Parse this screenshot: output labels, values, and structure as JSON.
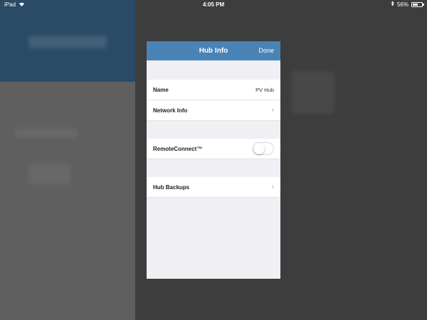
{
  "status_bar": {
    "device": "iPad",
    "time": "4:05 PM",
    "battery": "56%",
    "battery_level": 0.56
  },
  "modal": {
    "title": "Hub Info",
    "done_label": "Done",
    "rows": {
      "name": {
        "label": "Name",
        "value": "PV Hub"
      },
      "network_info": {
        "label": "Network Info"
      },
      "remote_connect": {
        "label": "RemoteConnect™",
        "enabled": false
      },
      "hub_backups": {
        "label": "Hub Backups"
      }
    }
  },
  "icons": {
    "wifi": "wifi-icon",
    "bluetooth": "bluetooth-icon",
    "battery": "battery-icon",
    "chevron": "chevron-right-icon"
  },
  "colors": {
    "nav_bar": "#4a83b5",
    "grouped_background": "#efeff4"
  }
}
